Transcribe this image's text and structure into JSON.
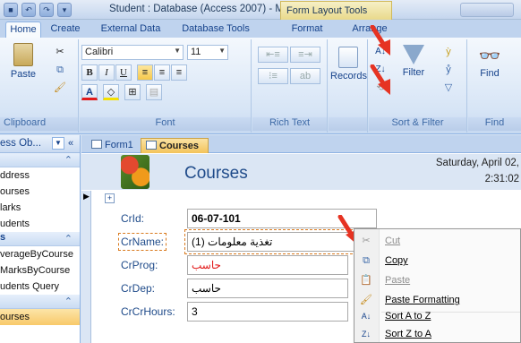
{
  "title_bar": {
    "title": "Student : Database (Access 2007) - M...",
    "context_tab_title": "Form Layout Tools"
  },
  "ribbon_tabs": [
    {
      "label": "Home",
      "active": true
    },
    {
      "label": "Create"
    },
    {
      "label": "External Data"
    },
    {
      "label": "Database Tools"
    },
    {
      "label": "Format"
    },
    {
      "label": "Arrange"
    }
  ],
  "ribbon": {
    "clipboard": {
      "paste": "Paste",
      "group": "Clipboard"
    },
    "font": {
      "name": "Calibri",
      "size": "11",
      "group": "Font"
    },
    "rich_text": {
      "group": "Rich Text"
    },
    "records": {
      "label": "Records"
    },
    "sort_filter": {
      "filter": "Filter",
      "group": "Sort & Filter"
    },
    "find": {
      "label": "Find",
      "group": "Find"
    }
  },
  "nav_pane": {
    "header": "ess Ob...",
    "groups": [
      {
        "label": "",
        "items": [
          "ddress",
          "ourses",
          "larks",
          "udents"
        ]
      },
      {
        "label": "s",
        "items": [
          "verageByCourse",
          "MarksByCourse",
          "udents Query"
        ]
      },
      {
        "label": "",
        "items": [
          "ourses"
        ]
      }
    ]
  },
  "doc_tabs": [
    {
      "label": "Form1",
      "active": false
    },
    {
      "label": "Courses",
      "active": true
    }
  ],
  "form": {
    "title": "Courses",
    "date": "Saturday, April 02,",
    "time": "2:31:02",
    "fields": [
      {
        "label": "CrId:",
        "value": "06-07-101"
      },
      {
        "label": "CrName:",
        "value": "تغذية معلومات (1)"
      },
      {
        "label": "CrProg:",
        "value": "حاسب"
      },
      {
        "label": "CrDep:",
        "value": "حاسب"
      },
      {
        "label": "CrCrHours:",
        "value": "3"
      }
    ]
  },
  "context_menu": {
    "items": [
      {
        "label": "Cut",
        "icon": "cut-icon",
        "disabled": true
      },
      {
        "label": "Copy",
        "icon": "copy-icon",
        "disabled": false
      },
      {
        "label": "Paste",
        "icon": "paste-icon",
        "disabled": true
      },
      {
        "label": "Paste Formatting",
        "icon": "paste-formatting-icon",
        "disabled": false
      },
      {
        "label": "Sort A to Z",
        "icon": "sort-ascending-icon",
        "disabled": false
      },
      {
        "label": "Sort Z to A",
        "icon": "sort-descending-icon",
        "disabled": false
      }
    ]
  },
  "colors": {
    "accent": "#15428b",
    "annotation_arrow": "#e63322",
    "context_tab": "#e9d98a"
  }
}
